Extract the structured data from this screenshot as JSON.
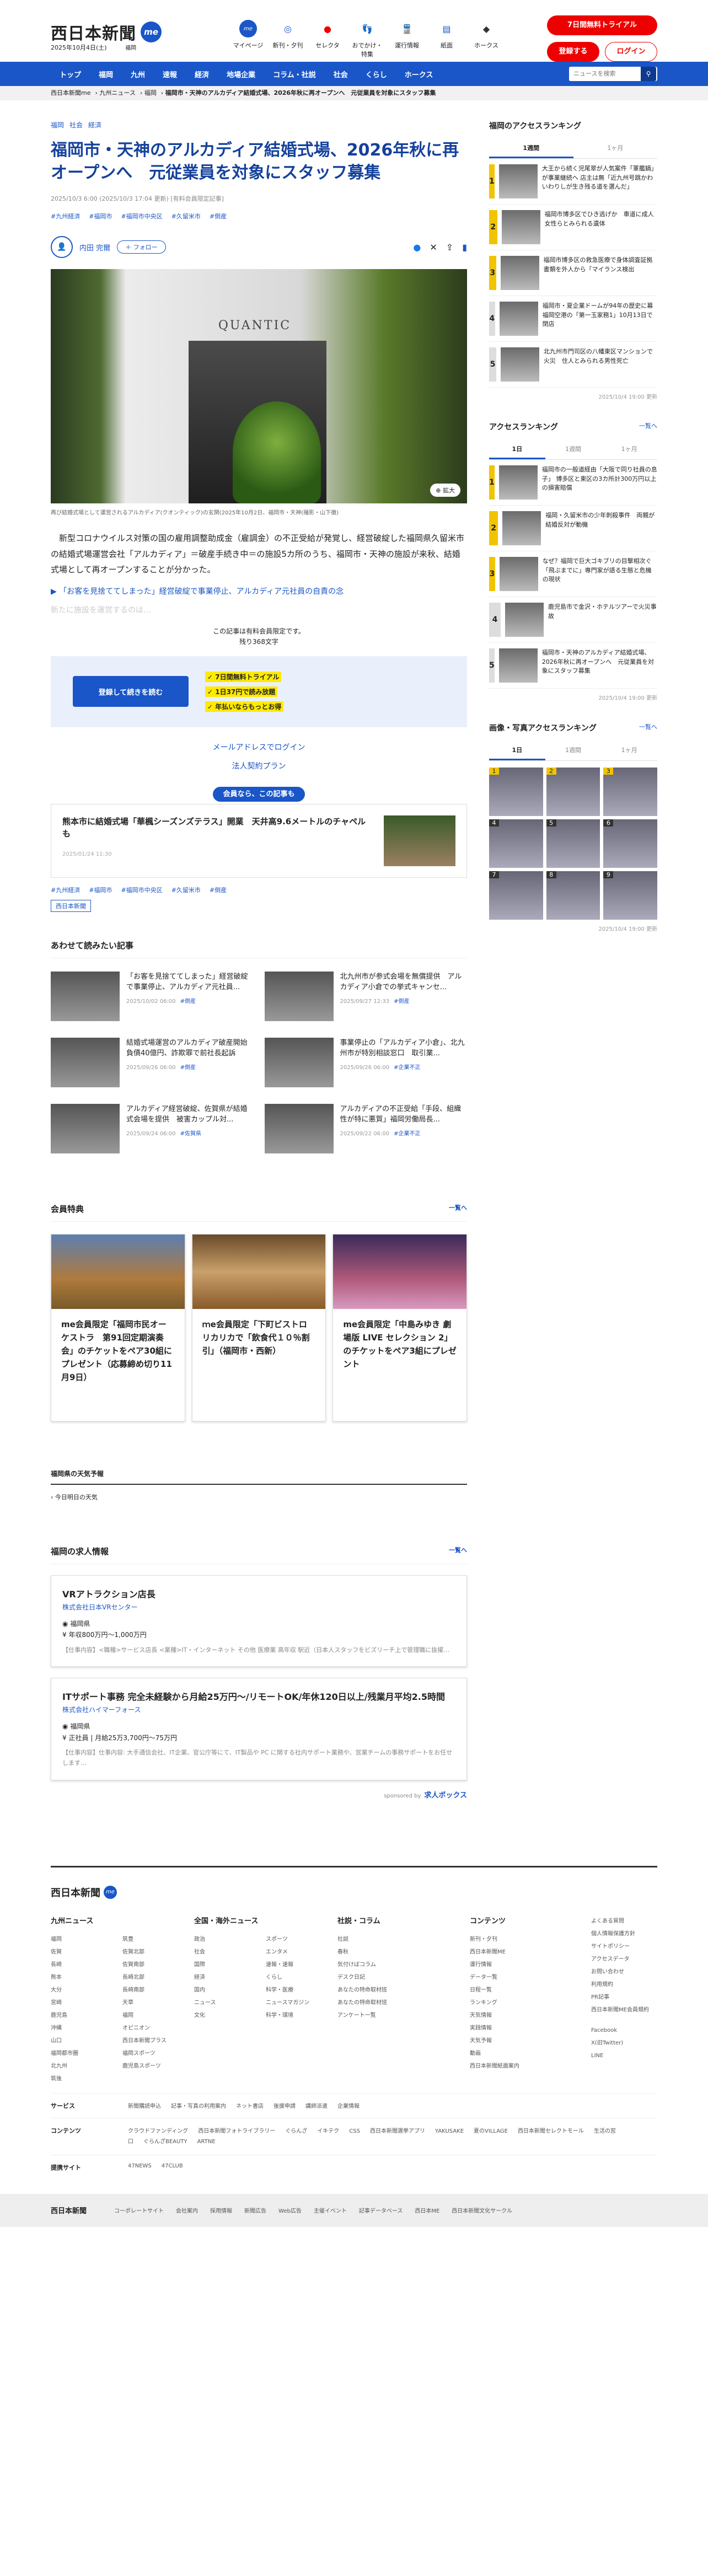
{
  "header": {
    "logo": "西日本新聞",
    "logo_me": "me",
    "date": "2025年10月4日(土)",
    "area": "福岡",
    "quick_nav": [
      {
        "label": "マイページ",
        "icon": "me-icon"
      },
      {
        "label": "新刊・夕刊",
        "icon": "newspaper-icon"
      },
      {
        "label": "セレクタ",
        "icon": "selecta-icon"
      },
      {
        "label": "おでかけ・特集",
        "icon": "footprint-icon"
      },
      {
        "label": "運行情報",
        "icon": "train-icon"
      },
      {
        "label": "紙面",
        "icon": "paper-icon"
      },
      {
        "label": "ホークス",
        "icon": "hawks-icon"
      }
    ],
    "trial": "7日間無料トライアル",
    "register": "登録する",
    "login": "ログイン"
  },
  "nav": {
    "items": [
      "トップ",
      "福岡",
      "九州",
      "速報",
      "経済",
      "地場企業",
      "コラム・社説",
      "社会",
      "くらし",
      "ホークス"
    ],
    "search_placeholder": "ニュースを検索"
  },
  "breadcrumb": [
    "西日本新聞me",
    "九州ニュース",
    "福岡",
    "福岡市・天神のアルカディア結婚式場、2026年秋に再オープンへ　元従業員を対象にスタッフ募集"
  ],
  "article": {
    "categories": [
      "福岡",
      "社会",
      "経済"
    ],
    "title": "福岡市・天神のアルカディア結婚式場、2026年秋に再オープンへ　元従業員を対象にスタッフ募集",
    "published": "2025/10/3 6:00 (2025/10/3 17:04 更新) [有料会員限定記事]",
    "tags": [
      "#九州経済",
      "#福岡市",
      "#福岡市中央区",
      "#久留米市",
      "#倒産"
    ],
    "author": "内田 完爾",
    "follow": "＋ フォロー",
    "photo_sign": "QUANTIC",
    "zoom": "拡大",
    "caption": "再び結婚式場として運営されるアルカディア(クオンティック)の玄関(2025年10月2日、福岡市・天神(撮影・山下徹)",
    "lead": "新型コロナウイルス対策の国の雇用調整助成金（雇調金）の不正受給が発覚し、経営破綻した福岡県久留米市の結婚式場運営会社「アルカディア」＝破産手続き中＝の施設5カ所のうち、福岡市・天神の施設が来秋、結婚式場として再オープンすることが分かった。",
    "related": "「お客を見捨ててしまった」経営破綻で事業停止、アルカディア元社員の自責の念",
    "fade": "新たに施設を運営するのは…",
    "paywall_1": "この記事は有料会員限定です。",
    "paywall_2": "残り368文字",
    "signup_btn": "登録して続きを読む",
    "benefits": [
      "7日間無料トライアル",
      "1日37円で読み放題",
      "年払いならもっとお得"
    ],
    "mail_login": "メールアドレスでログイン",
    "corp_plan": "法人契約プラン",
    "member_head": "会員なら、この記事も",
    "member_title": "熊本市に結婚式場「華楓シーズンズテラス」開業　天井高9.6メートルのチャペルも",
    "member_date": "2025/01/24 11:30",
    "tags2": [
      "#九州経済",
      "#福岡市",
      "#福岡市中央区",
      "#久留米市",
      "#倒産"
    ],
    "source": "西日本新聞"
  },
  "related_section": {
    "title": "あわせて読みたい記事",
    "items": [
      {
        "title": "「お客を見捨ててしまった」経営破綻で事業停止、アルカディア元社員...",
        "date": "2025/10/02 06:00",
        "tag": "#倒産"
      },
      {
        "title": "北九州市が参式会場を無償提供　アルカディア小倉での挙式キャンセ...",
        "date": "2025/09/27 12:33",
        "tag": "#倒産"
      },
      {
        "title": "結婚式場運営のアルカディア破産開始　負債40億円、詐欺罪で前社長起訴",
        "date": "2025/09/26 06:00",
        "tag": "#倒産"
      },
      {
        "title": "事業停止の「アルカディア小倉」、北九州市が特別相談窓口　取引業...",
        "date": "2025/09/26 06:00",
        "tag": "#企業不正"
      },
      {
        "title": "アルカディア経営破綻、佐賀県が結婚式会場を提供　被害カップル対...",
        "date": "2025/09/24 06:00",
        "tag": "#佐賀県"
      },
      {
        "title": "アルカディアの不正受給「手段、組織性が特に悪質」福岡労働局長...",
        "date": "2025/09/22 06:00",
        "tag": "#企業不正"
      }
    ]
  },
  "benefits_section": {
    "title": "会員特典",
    "more": "一覧へ",
    "items": [
      "me会員限定「福岡市民オーケストラ　第91回定期演奏会」のチケットをペア30組にプレゼント（応募締め切り11月9日）",
      "ｍe会員限定「下町ビストロ　リカリカで「飲食代１０％割引」（福岡市・西新）",
      "me会員限定「中島みゆき 劇場版 LIVE セレクション 2」のチケットをペア3組にプレゼント"
    ]
  },
  "weather": {
    "title": "福岡県の天気予報",
    "sub": "今日明日の天気"
  },
  "jobs": {
    "title": "福岡の求人情報",
    "more": "一覧へ",
    "items": [
      {
        "title": "VRアトラクション店長",
        "company": "株式会社日本VRセンター",
        "place": "福岡県",
        "pay": "年収800万円～1,000万円",
        "desc": "【仕事内容】<職種>サービス店長 <業種>IT・インターネット その他 医療業 高年収 駅近（日本人スタッフをビズリーチ上で管理職に抜擢…"
      },
      {
        "title": "ITサポート事務 完全未経験から月給25万円～/リモートOK/年休120日以上/残業月平均2.5時間",
        "company": "株式会社ハイマーフォース",
        "place": "福岡県",
        "pay": "正社員 | 月給25万3,700円～75万円",
        "desc": "【仕事内容】仕事内容: 大手通信会社、IT企業、官公庁等にて、IT製品や PC に関する社内サポート業務や、営業チームの事務サポートをお任せします…"
      }
    ],
    "sponsor": "sponsored by",
    "sponsor_name": "求人ボックス"
  },
  "sidebar": {
    "access_title": "福岡のアクセスランキング",
    "tabs1": [
      "1週間",
      "1ヶ月"
    ],
    "rank1": [
      "大王から続く児尾翠が人気案件「軍艦鍋」が事業継続へ 店主は無「近九州号跳かわいわりしが生き残る道を選んだ」",
      "福岡市博多区でひき逃げか　車道に成人女性らとみられる遺体",
      "福岡市博多区の救急医療で身体調査証拠書類を外人から「マイランス検出",
      "福岡市・夏企業ドームが94年の歴史に幕　福岡空港の「第一玉家務1」10月13日で閉店",
      "北九州市門司区の八幡東区マンションで火災　住人とみられる男性死亡"
    ],
    "rank1_updated": "2025/10/4 19:00 更新",
    "access2_title": "アクセスランキング",
    "access2_more": "一覧へ",
    "tabs2": [
      "1日",
      "1週間",
      "1ヶ月"
    ],
    "rank2": [
      "福岡市の一般道経由「大阪で同り社員の息子」 博多区と東区の3カ所計300万円以上の損害賠償",
      "福岡・久留米市の少年刺殺事件　両親が結婚反対が動機",
      "なぜ？福岡で巨大ゴキブリの目撃相次ぐ「飛ぶまでに」専門家が語る生態と危機の現状",
      "鹿児島市で金沢・ホテルツアーで火災事故",
      "福岡市・天神のアルカディア結婚式場、2026年秋に再オープンへ　元従業員を対象にスタッフ募集"
    ],
    "rank2_updated": "2025/10/4 19:00 更新",
    "photo_title": "画像・写真アクセスランキング",
    "photo_more": "一覧へ",
    "tabs3": [
      "1日",
      "1週間",
      "1ヶ月"
    ],
    "photo_nums": [
      "1",
      "2",
      "3",
      "4",
      "5",
      "6",
      "7",
      "8",
      "9"
    ],
    "photo_updated": "2025/10/4 19:00 更新"
  },
  "footer": {
    "logo": "西日本新聞",
    "cols": [
      {
        "title": "九州ニュース",
        "items": [
          "福岡",
          "佐賀",
          "長崎",
          "熊本",
          "大分",
          "宮崎",
          "鹿児島",
          "沖縄",
          "山口",
          "福岡都市圏",
          "北九州",
          "筑後",
          "筑豊",
          "佐賀北部",
          "佐賀南部",
          "長崎北部",
          "長崎南部",
          "天草",
          "福岡",
          "オピニオン",
          "西日本新聞プラス",
          "福岡スポーツ",
          "鹿児島スポーツ"
        ]
      },
      {
        "title": "全国・海外ニュース",
        "items": [
          "政治",
          "社会",
          "国際",
          "経済",
          "国内",
          "ニュース",
          "文化",
          "スポーツ",
          "エンタメ",
          "速報・速報",
          "くらし",
          "科学・医療",
          "ニュースマガジン",
          "科学・環境"
        ]
      },
      {
        "title": "社説・コラム",
        "items": [
          "社説",
          "春秋",
          "気付けばコラム",
          "デスク日記",
          "あなたの特命取材班",
          "あなたの特命取材班",
          "アンケート一覧"
        ]
      },
      {
        "title": "コンテンツ",
        "items": [
          "新刊・夕刊",
          "西日本新聞ME",
          "運行情報",
          "データ一覧",
          "日程一覧",
          "ランキング",
          "天気情報",
          "実践情報",
          "天気予報",
          "動画",
          "西日本新聞紙面案内"
        ]
      }
    ],
    "extra": [
      "よくある質問",
      "個人情報保護方針",
      "サイトポリシー",
      "アクセスデータ",
      "お問い合わせ",
      "利用規約",
      "PR記事",
      "西日本新聞ME会員規約"
    ],
    "sns": [
      "Facebook",
      "X(旧Twitter)",
      "LINE"
    ],
    "service_label": "サービス",
    "services": [
      "新聞購読申込",
      "記事・写真の利用案内",
      "ネット書店",
      "後援申請",
      "講師派遣",
      "企業情報"
    ],
    "content_label": "コンテンツ",
    "contents": [
      "クラウドファンディング",
      "西日本新聞フォトライブラリー",
      "ぐらんざ",
      "イキテク",
      "CSS",
      "西日本新聞選挙アプリ",
      "YAKUSAKE",
      "夏のVILLAGE",
      "西日本新聞セレクトモール",
      "生活の窓口",
      "ぐらんざBEAUTY",
      "ARTNE"
    ],
    "partner_label": "提携サイト",
    "partners": [
      "47NEWS",
      "47CLUB"
    ],
    "bottom_logo": "西日本新聞",
    "bottom": [
      "コーポレートサイト",
      "会社案内",
      "採用情報",
      "新聞広告",
      "Web広告",
      "主催イベント",
      "記事データベース",
      "西日本ME",
      "西日本新聞文化サークル"
    ]
  }
}
